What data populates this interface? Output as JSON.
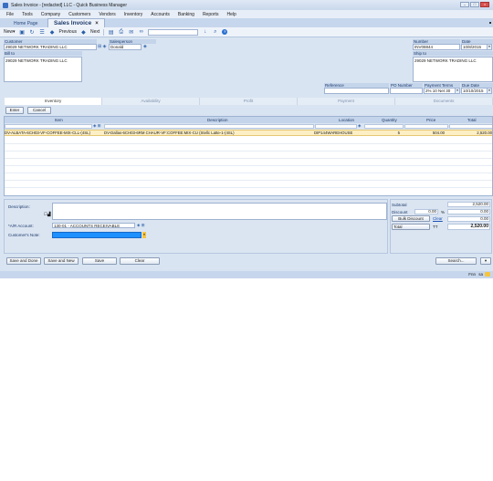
{
  "window": {
    "title": "Sales Invoice - [redacted] LLC - Quick Business Manager"
  },
  "menu": [
    "File",
    "Tools",
    "Company",
    "Customers",
    "Vendors",
    "Inventory",
    "Accounts",
    "Banking",
    "Reports",
    "Help"
  ],
  "tabs": {
    "home": "Home Page",
    "active": "Sales Invoice"
  },
  "toolbar": {
    "new_label": "New",
    "previous_label": "Previous",
    "next_label": "Next"
  },
  "header": {
    "customer_label": "Customer",
    "customer_value": "29029 NETWORK TRADING LLC",
    "salesperson_label": "Salesperson",
    "salesperson_value": "Donald",
    "number_label": "Number",
    "number_value": "INV08844",
    "date_label": "Date",
    "date_value": "10/8/2015",
    "bill_to_label": "Bill to",
    "bill_to_value": "29029 NETWORK TRADING LLC",
    "ship_to_label": "Ship to",
    "ship_to_value": "29029 NETWORK TRADING LLC",
    "reference_label": "Reference",
    "reference_value": "",
    "po_number_label": "PO Number",
    "po_number_value": "",
    "payment_terms_label": "Payment Terms",
    "payment_terms_value": "2% 10 Net 30",
    "due_date_label": "Due Date",
    "due_date_value": "10/10/2015"
  },
  "subtabs": [
    "Inventory",
    "Availability",
    "Profit",
    "Payment",
    "Documents"
  ],
  "actions": {
    "enter": "Enter",
    "cancel": "Cancel"
  },
  "grid": {
    "columns": [
      "Item",
      "Description",
      "Location",
      "Quantity",
      "Price",
      "Total"
    ],
    "rows": [
      {
        "item": "DV-ALBATA-6CH03-VF-COFFEE-MIX-CLL-(4SL)",
        "description": "DV-Dallas-6CH03-6RM CHAUR-VF:COFFEE:MIX-CU (Stellc Latte-1-(4SL)",
        "location": "DIP144WAREHOUSE",
        "quantity": "5",
        "price": "504.00",
        "total": "2,520.00"
      }
    ]
  },
  "bottom": {
    "description_label": "Description:",
    "ar_account_label": "*A/R Account:",
    "ar_account_value": "130-01 - ACCOUNTS RECEIVABLE",
    "customer_note_label": "Customer's Note:"
  },
  "totals": {
    "subtotal_label": "Subtotal",
    "subtotal_value": "2,520.00",
    "discount_label": "Discount",
    "discount_pct": "0.00",
    "discount_pct_sign": "%",
    "discount_value": "0.00",
    "bulk_discount_label": "Bulk Discount",
    "clear_label": "Clear",
    "bulk_value": "0.00",
    "total_label": "Total",
    "currency": "TT",
    "total_value": "2,520.00"
  },
  "footer": {
    "save_done": "Save and Done",
    "save_new": "Save and New",
    "save": "Save",
    "clear": "Clear",
    "search": "Search..."
  },
  "statusbar": {
    "lang": "Fnn",
    "user": "sa"
  },
  "colors": {
    "accent": "#2a6fd1",
    "highlight_row": "#fcefc5",
    "note_field": "#1e90ff"
  }
}
